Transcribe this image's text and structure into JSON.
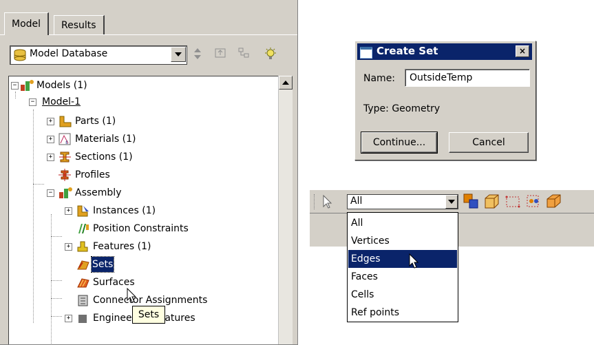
{
  "tabs": {
    "model": "Model",
    "results": "Results"
  },
  "database_combo": {
    "value": "Model Database"
  },
  "tree": {
    "models": "Models (1)",
    "model1": "Model-1",
    "parts": "Parts (1)",
    "materials": "Materials (1)",
    "sections": "Sections (1)",
    "profiles": "Profiles",
    "assembly": "Assembly",
    "instances": "Instances (1)",
    "position_constraints": "Position Constraints",
    "features": "Features (1)",
    "sets": "Sets",
    "surfaces": "Surfaces",
    "connector_assignments": "Connector Assignments",
    "engineering_features": "Engineering Features"
  },
  "tooltip": "Sets",
  "dialog": {
    "title": "Create Set",
    "close": "×",
    "name_label": "Name:",
    "name_value": "OutsideTemp",
    "type_text": "Type: Geometry",
    "continue": "Continue...",
    "cancel": "Cancel"
  },
  "toolbar": {
    "select_value": "All",
    "options": [
      "All",
      "Vertices",
      "Edges",
      "Faces",
      "Cells",
      "Ref points"
    ],
    "highlighted_option": "Edges"
  },
  "colors": {
    "selection": "#0a246a",
    "panel": "#d4d0c8",
    "tooltip": "#ffffe1"
  }
}
